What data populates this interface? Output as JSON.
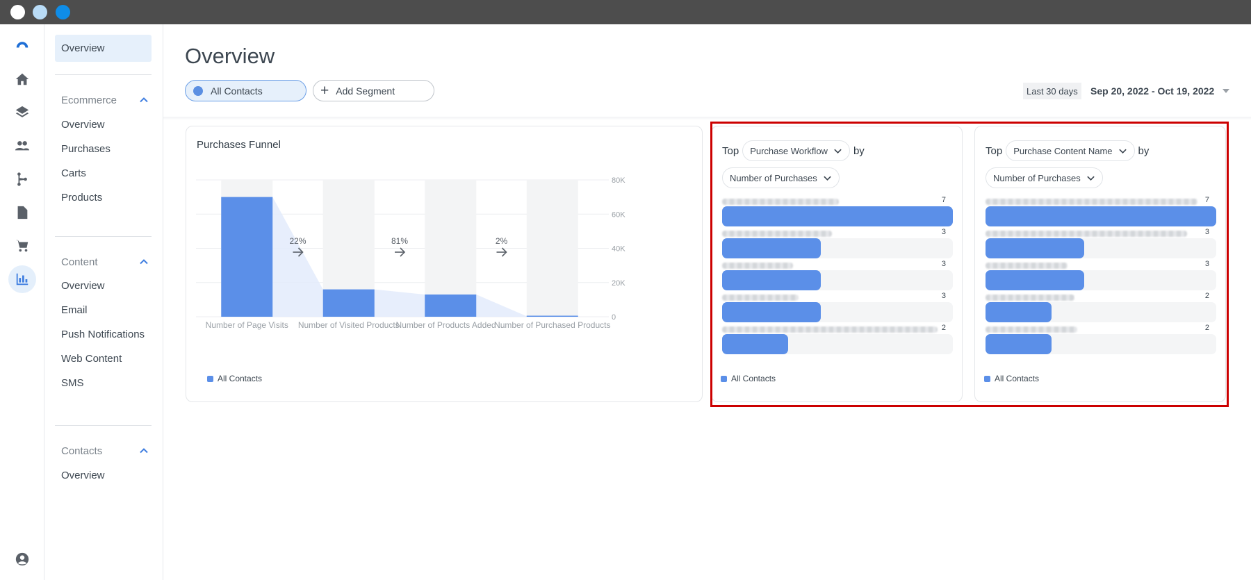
{
  "nav": {
    "top_item": "Overview",
    "sections": [
      {
        "title": "Ecommerce",
        "items": [
          "Overview",
          "Purchases",
          "Carts",
          "Products"
        ]
      },
      {
        "title": "Content",
        "items": [
          "Overview",
          "Email",
          "Push Notifications",
          "Web Content",
          "SMS"
        ]
      },
      {
        "title": "Contacts",
        "items": [
          "Overview"
        ]
      }
    ]
  },
  "header": {
    "title": "Overview",
    "segments": {
      "all": "All Contacts",
      "add": "Add Segment"
    },
    "range_chip": "Last 30 days",
    "date_range": "Sep 20, 2022 - Oct 19, 2022"
  },
  "funnel": {
    "title": "Purchases Funnel",
    "legend": "All Contacts"
  },
  "chart_data": [
    {
      "type": "bar",
      "title": "Purchases Funnel",
      "categories": [
        "Number of Page Visits",
        "Number of Visited Products",
        "Number of Products Added ...",
        "Number of Purchased Products"
      ],
      "series": [
        {
          "name": "All Contacts",
          "values": [
            70000,
            16000,
            13000,
            300
          ]
        }
      ],
      "conversion_labels": [
        "22%",
        "81%",
        "2%"
      ],
      "ylim": [
        0,
        80000
      ],
      "yticks": [
        "80K",
        "60K",
        "40K",
        "20K",
        "0"
      ],
      "grid": true,
      "legend": "bottom-left"
    },
    {
      "type": "bar",
      "orientation": "horizontal",
      "series": [
        {
          "name": "All Contacts",
          "values": [
            7,
            3,
            3,
            3,
            2
          ]
        }
      ],
      "xlim": [
        0,
        7
      ]
    },
    {
      "type": "bar",
      "orientation": "horizontal",
      "series": [
        {
          "name": "All Contacts",
          "values": [
            7,
            3,
            3,
            2,
            2
          ]
        }
      ],
      "xlim": [
        0,
        7
      ]
    }
  ],
  "top_cards": [
    {
      "top": "Top",
      "dimension": "Purchase Workflow",
      "by": "by",
      "metric": "Number of Purchases",
      "legend": "All Contacts"
    },
    {
      "top": "Top",
      "dimension": "Purchase Content Name",
      "by": "by",
      "metric": "Number of Purchases",
      "legend": "All Contacts"
    }
  ],
  "colors": {
    "accent": "#5b8fe8",
    "highlight": "#cc0000"
  }
}
